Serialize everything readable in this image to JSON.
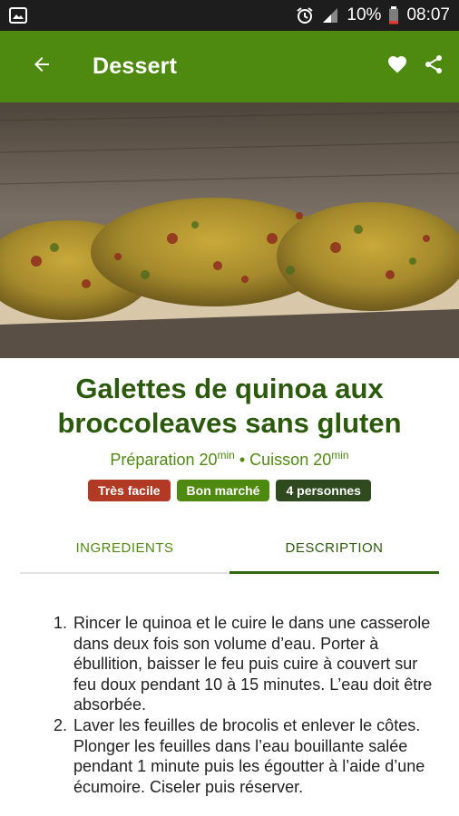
{
  "status_bar": {
    "battery_percent": "10%",
    "time": "08:07",
    "icons": [
      "image-icon",
      "alarm-icon",
      "signal-icon",
      "battery-icon"
    ]
  },
  "app_bar": {
    "title": "Dessert",
    "icons": [
      "back-arrow-icon",
      "heart-icon",
      "share-icon"
    ]
  },
  "recipe": {
    "title": "Galettes de quinoa aux broccoleaves sans gluten",
    "prep_label": "Préparation 20",
    "prep_unit": "min",
    "separator": " • ",
    "cook_label": "Cuisson 20",
    "cook_unit": "min",
    "badges": [
      {
        "label": "Très facile",
        "color": "#b23a24"
      },
      {
        "label": "Bon marché",
        "color": "#4f8a10"
      },
      {
        "label": "4 personnes",
        "color": "#2f4a1e"
      }
    ]
  },
  "tabs": [
    {
      "label": "INGREDIENTS",
      "active": false
    },
    {
      "label": "DESCRIPTION",
      "active": true
    }
  ],
  "steps": [
    "Rincer le quinoa et le cuire le dans une casserole dans deux fois son volume d’eau. Porter à ébullition, baisser le feu puis cuire à couvert sur feu doux pendant 10 à 15 minutes. L’eau doit être absorbée.",
    "Laver les feuilles de brocolis et enlever le côtes. Plonger les feuilles dans l’eau bouillante salée pendant 1 minute puis les égoutter à l’aide d’une écumoire. Ciseler puis réserver."
  ],
  "colors": {
    "app_bar": "#4f8a10",
    "title_text": "#2c5a0c",
    "status_bar": "#1d1d1d"
  }
}
